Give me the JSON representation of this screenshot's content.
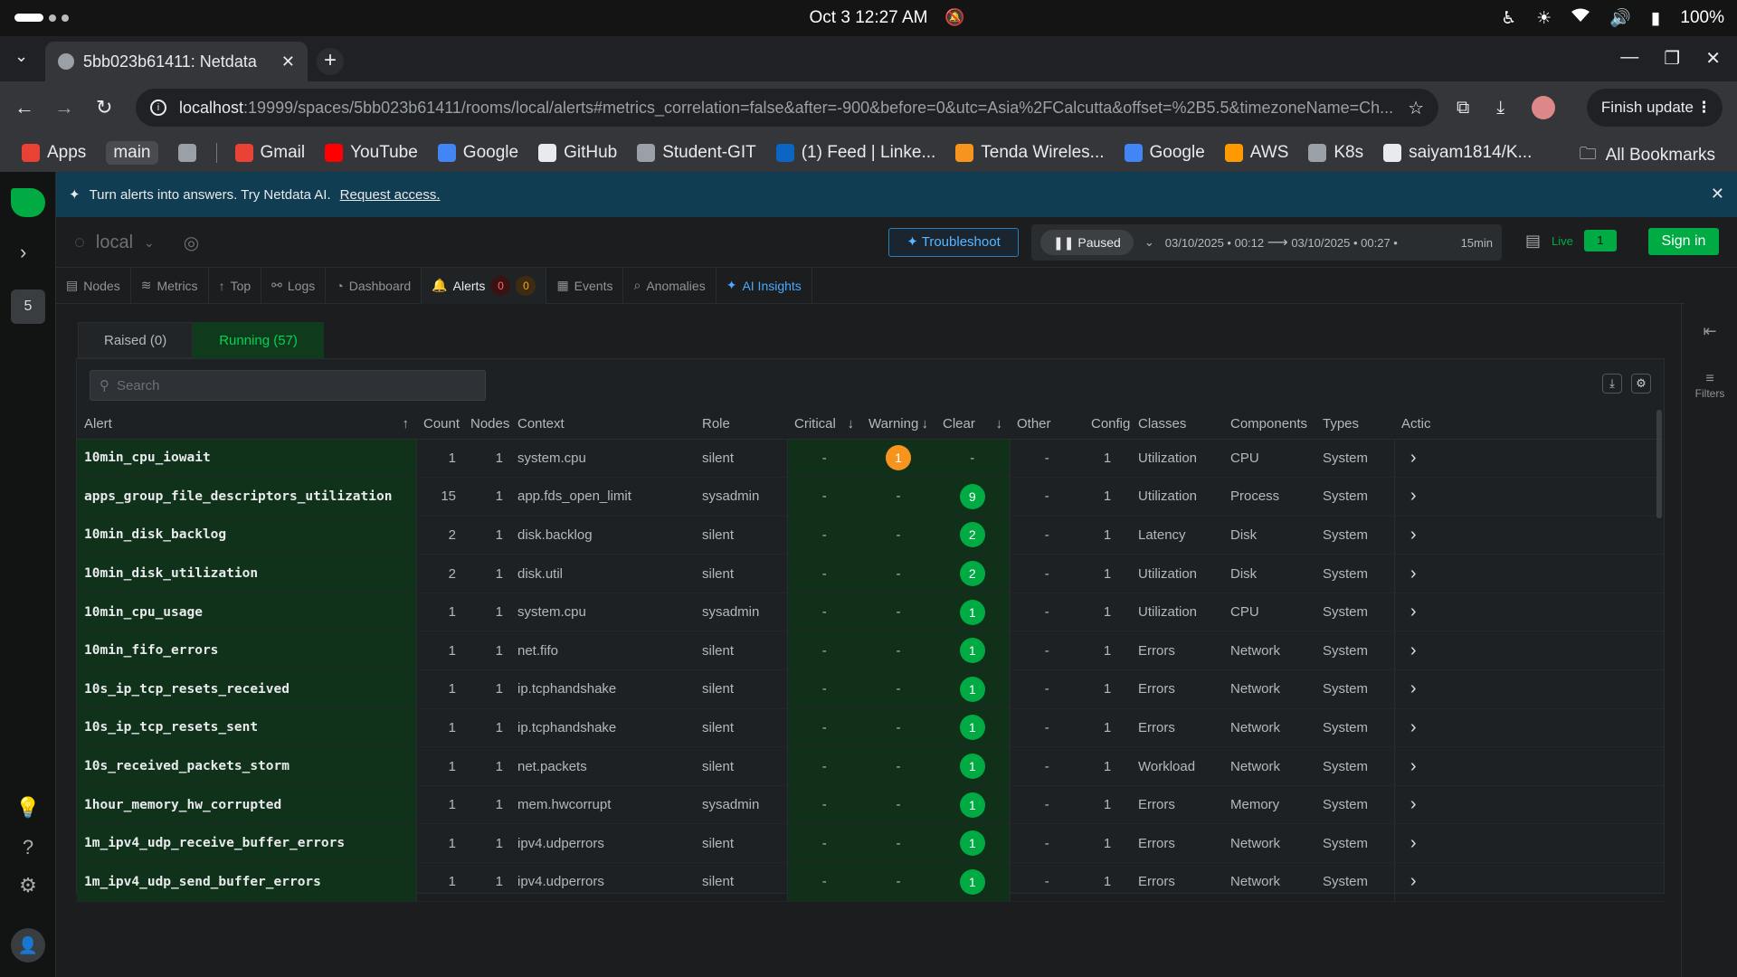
{
  "os": {
    "clock": "Oct 3  12:27 AM",
    "battery": "100%"
  },
  "browser": {
    "tab_title": "5bb023b61411: Netdata",
    "url_host": "localhost",
    "url_rest": ":19999/spaces/5bb023b61411/rooms/local/alerts#metrics_correlation=false&after=-900&before=0&utc=Asia%2FCalcutta&offset=%2B5.5&timezoneName=Ch...",
    "finish_update": "Finish update",
    "bookmarks": [
      {
        "label": "Apps",
        "color": "#e94235"
      },
      {
        "label": "main",
        "color": ""
      },
      {
        "label": "",
        "color": "#9aa0a6"
      },
      {
        "label": "Gmail",
        "color": "#ea4335"
      },
      {
        "label": "YouTube",
        "color": "#ff0000"
      },
      {
        "label": "Google",
        "color": "#4285f4"
      },
      {
        "label": "GitHub",
        "color": "#e8eaed"
      },
      {
        "label": "Student-GIT",
        "color": "#9aa0a6"
      },
      {
        "label": "(1) Feed | Linke...",
        "color": "#0a66c2"
      },
      {
        "label": "Tenda Wireles...",
        "color": "#f7941d"
      },
      {
        "label": "Google",
        "color": "#4285f4"
      },
      {
        "label": "AWS",
        "color": "#ff9900"
      },
      {
        "label": "K8s",
        "color": "#9aa0a6"
      },
      {
        "label": "saiyam1814/K...",
        "color": "#e8eaed"
      }
    ],
    "all_bookmarks": "All Bookmarks"
  },
  "netdata": {
    "banner": {
      "text": "Turn alerts into answers. Try Netdata AI.",
      "link": "Request access."
    },
    "room": "local",
    "space_badge": "5",
    "troubleshoot": "Troubleshoot",
    "paused": "Paused",
    "time_from": "03/10/2025 • 00:12",
    "time_to": "03/10/2025 • 00:27 •",
    "duration": "15min",
    "live_label": "Live",
    "live_count": "1",
    "sign_in": "Sign in",
    "nav_tabs": {
      "nodes": "Nodes",
      "metrics": "Metrics",
      "top": "Top",
      "logs": "Logs",
      "dashboard": "Dashboard",
      "alerts": "Alerts",
      "alerts_critical": "0",
      "alerts_warning": "0",
      "events": "Events",
      "anomalies": "Anomalies",
      "ai_insights": "AI Insights"
    },
    "filters_label": "Filters",
    "subtabs": {
      "raised": "Raised (0)",
      "running": "Running (57)"
    },
    "search_placeholder": "Search",
    "columns": [
      "Alert",
      "Count",
      "Nodes",
      "Context",
      "Role",
      "Critical",
      "Warning",
      "Clear",
      "Other",
      "Config",
      "Classes",
      "Components",
      "Types",
      "Actic"
    ],
    "rows": [
      {
        "alert": "10min_cpu_iowait",
        "count": "1",
        "nodes": "1",
        "context": "system.cpu",
        "role": "silent",
        "critical": "-",
        "warning": "1",
        "clear": "-",
        "other": "-",
        "config": "1",
        "class": "Utilization",
        "component": "CPU",
        "type": "System"
      },
      {
        "alert": "apps_group_file_descriptors_utilization",
        "count": "15",
        "nodes": "1",
        "context": "app.fds_open_limit",
        "role": "sysadmin",
        "critical": "-",
        "warning": "-",
        "clear": "9",
        "other": "-",
        "config": "1",
        "class": "Utilization",
        "component": "Process",
        "type": "System"
      },
      {
        "alert": "10min_disk_backlog",
        "count": "2",
        "nodes": "1",
        "context": "disk.backlog",
        "role": "silent",
        "critical": "-",
        "warning": "-",
        "clear": "2",
        "other": "-",
        "config": "1",
        "class": "Latency",
        "component": "Disk",
        "type": "System"
      },
      {
        "alert": "10min_disk_utilization",
        "count": "2",
        "nodes": "1",
        "context": "disk.util",
        "role": "silent",
        "critical": "-",
        "warning": "-",
        "clear": "2",
        "other": "-",
        "config": "1",
        "class": "Utilization",
        "component": "Disk",
        "type": "System"
      },
      {
        "alert": "10min_cpu_usage",
        "count": "1",
        "nodes": "1",
        "context": "system.cpu",
        "role": "sysadmin",
        "critical": "-",
        "warning": "-",
        "clear": "1",
        "other": "-",
        "config": "1",
        "class": "Utilization",
        "component": "CPU",
        "type": "System"
      },
      {
        "alert": "10min_fifo_errors",
        "count": "1",
        "nodes": "1",
        "context": "net.fifo",
        "role": "silent",
        "critical": "-",
        "warning": "-",
        "clear": "1",
        "other": "-",
        "config": "1",
        "class": "Errors",
        "component": "Network",
        "type": "System"
      },
      {
        "alert": "10s_ip_tcp_resets_received",
        "count": "1",
        "nodes": "1",
        "context": "ip.tcphandshake",
        "role": "silent",
        "critical": "-",
        "warning": "-",
        "clear": "1",
        "other": "-",
        "config": "1",
        "class": "Errors",
        "component": "Network",
        "type": "System"
      },
      {
        "alert": "10s_ip_tcp_resets_sent",
        "count": "1",
        "nodes": "1",
        "context": "ip.tcphandshake",
        "role": "silent",
        "critical": "-",
        "warning": "-",
        "clear": "1",
        "other": "-",
        "config": "1",
        "class": "Errors",
        "component": "Network",
        "type": "System"
      },
      {
        "alert": "10s_received_packets_storm",
        "count": "1",
        "nodes": "1",
        "context": "net.packets",
        "role": "silent",
        "critical": "-",
        "warning": "-",
        "clear": "1",
        "other": "-",
        "config": "1",
        "class": "Workload",
        "component": "Network",
        "type": "System"
      },
      {
        "alert": "1hour_memory_hw_corrupted",
        "count": "1",
        "nodes": "1",
        "context": "mem.hwcorrupt",
        "role": "sysadmin",
        "critical": "-",
        "warning": "-",
        "clear": "1",
        "other": "-",
        "config": "1",
        "class": "Errors",
        "component": "Memory",
        "type": "System"
      },
      {
        "alert": "1m_ipv4_udp_receive_buffer_errors",
        "count": "1",
        "nodes": "1",
        "context": "ipv4.udperrors",
        "role": "silent",
        "critical": "-",
        "warning": "-",
        "clear": "1",
        "other": "-",
        "config": "1",
        "class": "Errors",
        "component": "Network",
        "type": "System"
      },
      {
        "alert": "1m_ipv4_udp_send_buffer_errors",
        "count": "1",
        "nodes": "1",
        "context": "ipv4.udperrors",
        "role": "silent",
        "critical": "-",
        "warning": "-",
        "clear": "1",
        "other": "-",
        "config": "1",
        "class": "Errors",
        "component": "Network",
        "type": "System"
      }
    ]
  },
  "colors": {
    "accent_green": "#00ab44",
    "warning_orange": "#f7941d",
    "banner_blue": "#103d52",
    "ai_blue": "#4aa8ff"
  }
}
